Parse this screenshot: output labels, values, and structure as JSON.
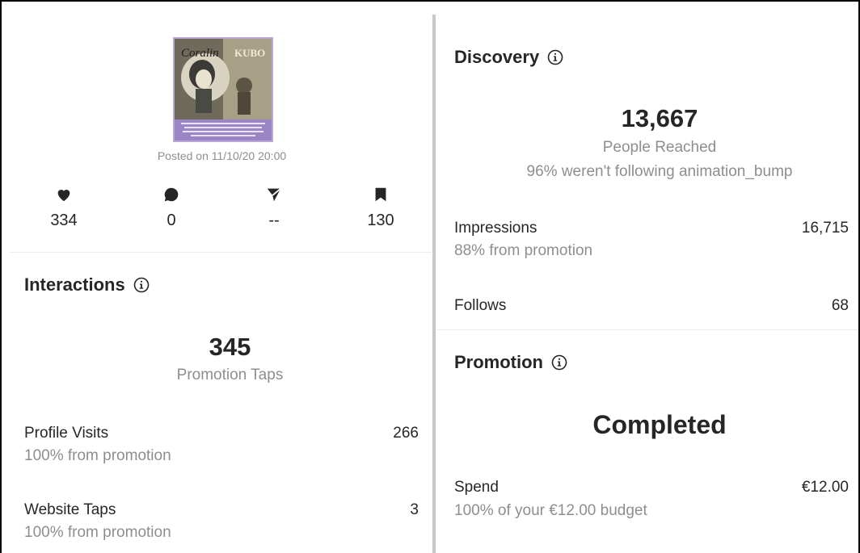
{
  "post": {
    "posted": "Posted on 11/10/20 20:00",
    "stats": [
      {
        "icon": "heart-icon",
        "value": "334"
      },
      {
        "icon": "comment-icon",
        "value": "0"
      },
      {
        "icon": "share-icon",
        "value": "--"
      },
      {
        "icon": "bookmark-icon",
        "value": "130"
      }
    ]
  },
  "interactions": {
    "title": "Interactions",
    "total": "345",
    "total_label": "Promotion Taps",
    "rows": [
      {
        "label": "Profile Visits",
        "value": "266",
        "sub": "100% from promotion"
      },
      {
        "label": "Website Taps",
        "value": "3",
        "sub": "100% from promotion"
      }
    ]
  },
  "discovery": {
    "title": "Discovery",
    "total": "13,667",
    "total_label": "People Reached",
    "total_sub": "96% weren't following animation_bump",
    "rows": [
      {
        "label": "Impressions",
        "value": "16,715",
        "sub": "88% from promotion"
      },
      {
        "label": "Follows",
        "value": "68"
      }
    ]
  },
  "promotion": {
    "title": "Promotion",
    "status": "Completed",
    "rows": [
      {
        "label": "Spend",
        "value": "€12.00",
        "sub": "100% of your €12.00 budget"
      }
    ]
  },
  "colors": {
    "text": "#262626",
    "muted": "#8e8e8e",
    "divider": "#c8c8c8"
  }
}
